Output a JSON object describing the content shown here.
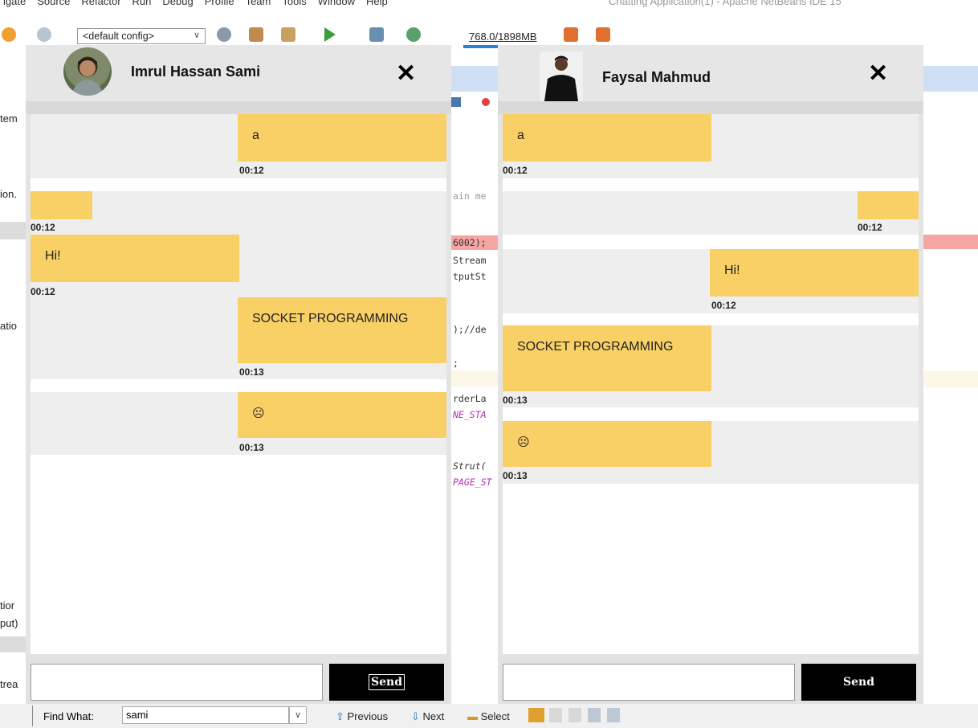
{
  "ide": {
    "menu": [
      "igate",
      "Source",
      "Refactor",
      "Run",
      "Debug",
      "Profile",
      "Team",
      "Tools",
      "Window",
      "Help"
    ],
    "title": "Chatting Application(1) - Apache NetBeans IDE 15",
    "config": "<default config>",
    "memory": "768.0/1898MB",
    "left_fragments": [
      "tem",
      "ion.",
      "atio",
      "tior",
      "put)",
      "trea"
    ],
    "code_fragments": [
      "ain me",
      "6002);",
      "Stream",
      "tputSt",
      ");//de",
      ";",
      "rderLa",
      "NE_STA",
      "Strut(",
      "PAGE_ST"
    ],
    "find": {
      "label": "Find What:",
      "value": "sami",
      "previous": "Previous",
      "next": "Next",
      "select": "Select"
    }
  },
  "chat_left": {
    "name": "Imrul Hassan Sami",
    "close": "✕",
    "send": "Send",
    "messages": [
      {
        "text": "a",
        "time": "00:12",
        "side": "right"
      },
      {
        "text": "",
        "time": "00:12",
        "side": "left"
      },
      {
        "text": "Hi!",
        "time": "00:12",
        "side": "left"
      },
      {
        "text": "SOCKET PROGRAMMING",
        "time": "00:13",
        "side": "right"
      },
      {
        "text": "☹",
        "time": "00:13",
        "side": "right"
      }
    ]
  },
  "chat_right": {
    "name": "Faysal Mahmud",
    "close": "✕",
    "send": "Send",
    "messages": [
      {
        "text": "a",
        "time": "00:12",
        "side": "left"
      },
      {
        "text": "",
        "time": "00:12",
        "side": "right"
      },
      {
        "text": "Hi!",
        "time": "00:12",
        "side": "right"
      },
      {
        "text": "SOCKET PROGRAMMING",
        "time": "00:13",
        "side": "left"
      },
      {
        "text": "☹",
        "time": "00:13",
        "side": "left"
      }
    ]
  },
  "colors": {
    "bubble": "#f8d066",
    "send_bg": "#000000",
    "row_bg": "#eeeeee"
  }
}
